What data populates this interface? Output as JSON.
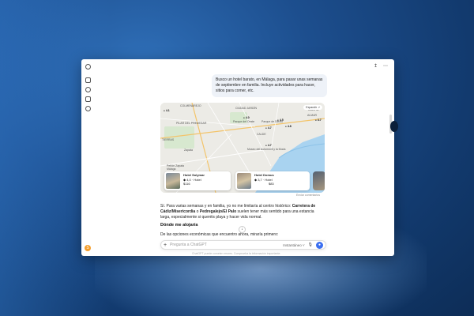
{
  "window": {
    "top_actions": [
      {
        "icon": "share-icon",
        "glyph": "↥"
      },
      {
        "icon": "more-icon",
        "glyph": "⋯"
      }
    ]
  },
  "sidebar": {
    "icons": [
      "openai-logo-icon",
      "new-chat-icon",
      "search-icon",
      "images-icon",
      "explore-icon"
    ],
    "avatar_initial": "S"
  },
  "conversation": {
    "user_message": "Busco un hotel barato, en Málaga, para pasar unas semanas de septiembre en familia. Incluye actividades para hacer, sitios para comer, etc.",
    "map": {
      "expand_label": "Expandir ↗",
      "area_labels": [
        "COLMENAREJO",
        "PILAR DEL PREDEGAR",
        "TIERRAS",
        "Zapata",
        "CIUDAD JARDÍN",
        "CALDE",
        "ALMAR",
        "CALETA"
      ],
      "pois": [
        {
          "label": "4.1"
        },
        {
          "label": "4.0"
        },
        {
          "label": "4.5"
        },
        {
          "label": "4.7"
        },
        {
          "label": "3.7"
        },
        {
          "label": "4.8"
        },
        {
          "label": "4.7"
        }
      ],
      "place_labels": [
        "Parque del Oeste",
        "Museo del Automóvil y la Moda",
        "Parque de Diezto",
        "Peñón Zapata Málaga"
      ],
      "hotels": [
        {
          "name": "Hotel Solymar",
          "rating": "4,0 · Hotel",
          "price": "$116"
        },
        {
          "name": "Hotel Domus",
          "rating": "3,7 · Hotel",
          "price": "$83"
        }
      ],
      "caption": "Enviar comentarios"
    },
    "answer_intro_parts": [
      "Sí. Para varias semanas y en familia, yo no me limitaría al centro histórico: ",
      "Carretera de Cádiz/Misericordia",
      " o ",
      "Pedregalejo/El Palo",
      " suelen tener más sentido para una estancia larga, especialmente si queréis playa y hacer vida normal."
    ],
    "section_title": "Dónde me alojaría",
    "section_text": "De las opciones económicas que encuentro ahora, miraría primero:"
  },
  "composer": {
    "placeholder": "Pregunta a ChatGPT",
    "model_label": "Instantáneo ˅",
    "scroll_down_glyph": "↓"
  },
  "footnote": "ChatGPT puede cometer errores. Comprueba la información importante."
}
